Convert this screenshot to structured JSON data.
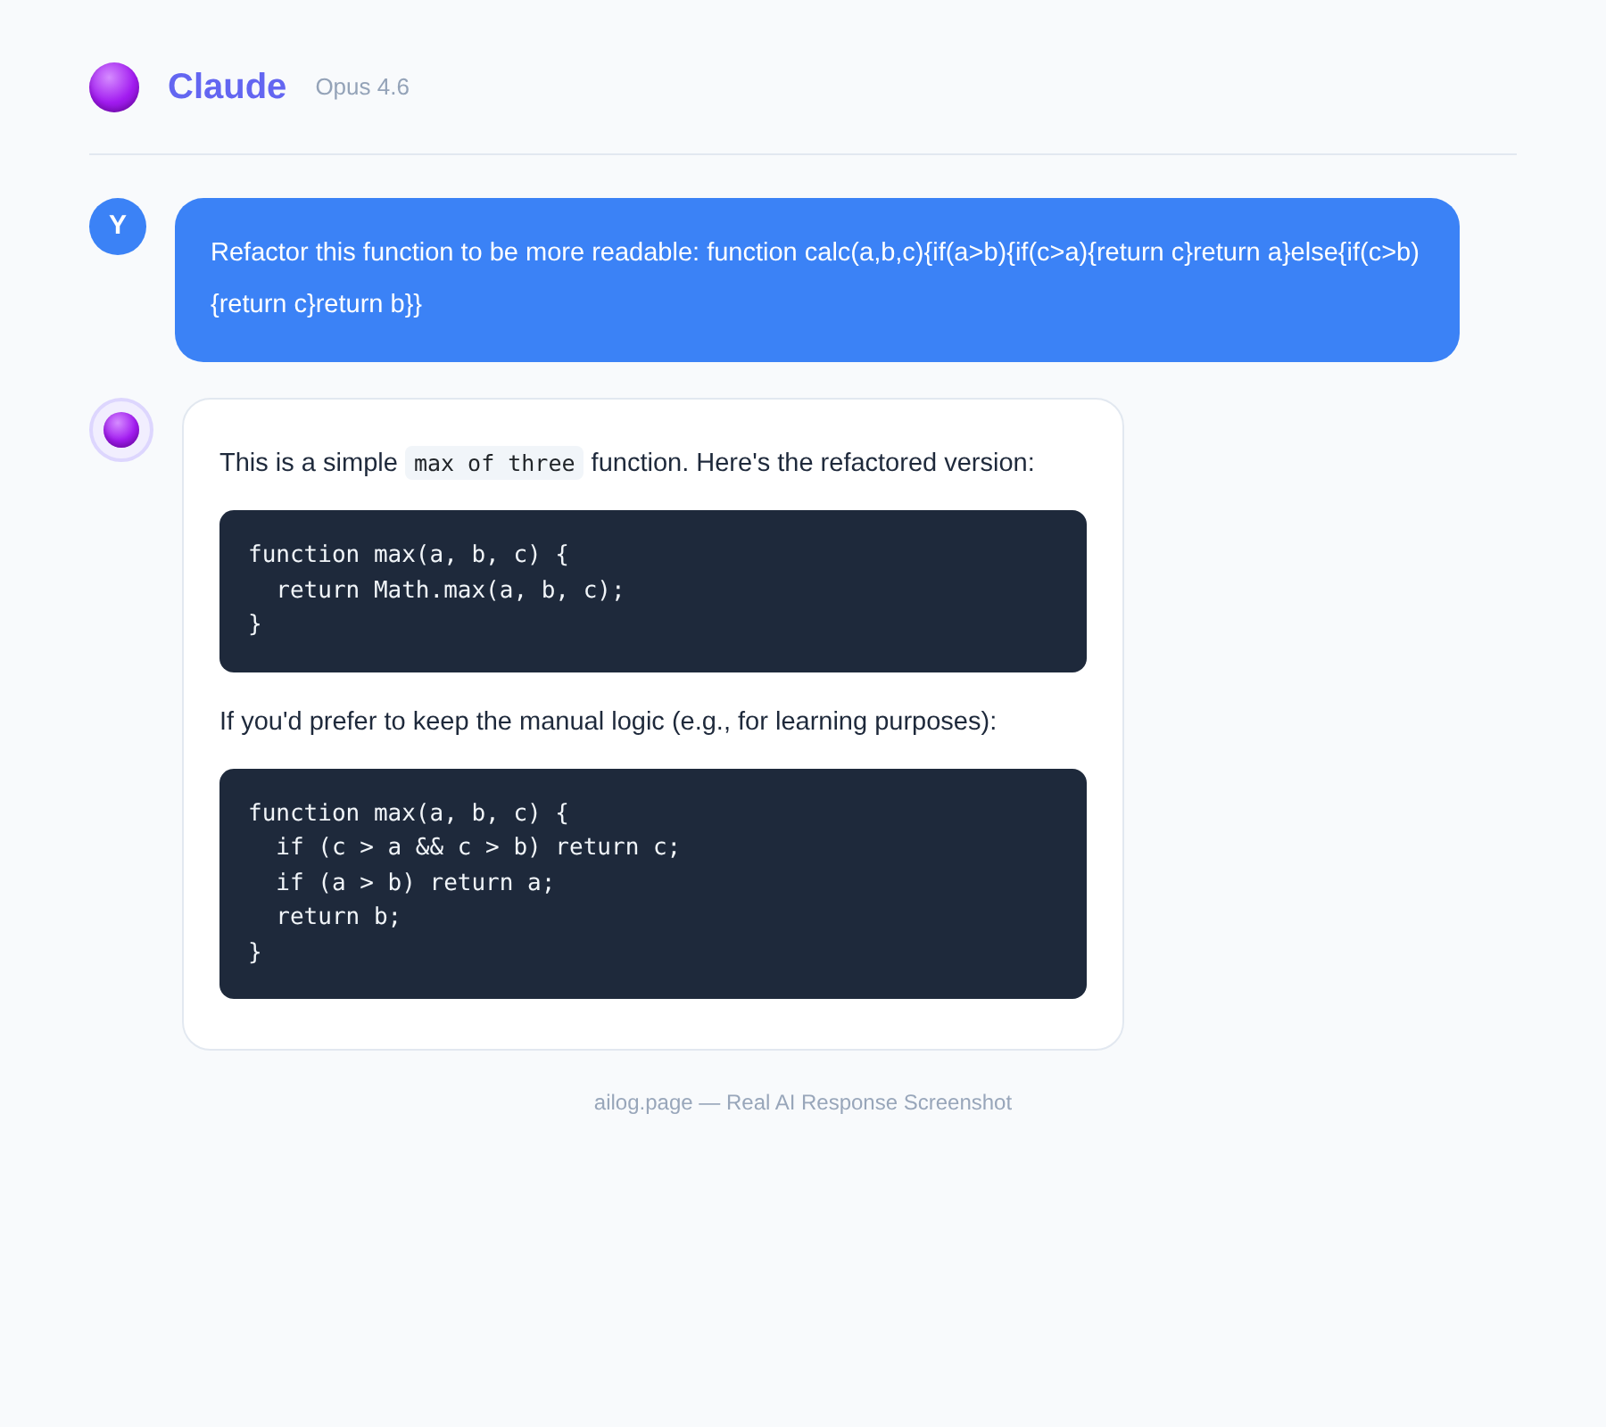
{
  "header": {
    "title": "Claude",
    "model": "Opus 4.6"
  },
  "messages": [
    {
      "kind": "user",
      "avatar": "Y",
      "text": "Refactor this function to be more readable: function calc(a,b,c){if(a>b){if(c>a){return c}return a}else{if(c>b){return c}return b}}"
    },
    {
      "kind": "assistant",
      "blocks": [
        {
          "kind": "paragraph",
          "parts": [
            {
              "kind": "text",
              "text": "This is a simple "
            },
            {
              "kind": "code",
              "text": "max of three"
            },
            {
              "kind": "text",
              "text": " function. Here's the refactored version:"
            }
          ]
        },
        {
          "kind": "code",
          "lines": [
            "function max(a, b, c) {",
            "  return Math.max(a, b, c);",
            "}"
          ]
        },
        {
          "kind": "paragraph",
          "parts": [
            {
              "kind": "text",
              "text": "If you'd prefer to keep the manual logic (e.g., for learning purposes):"
            }
          ]
        },
        {
          "kind": "code",
          "lines": [
            "function max(a, b, c) {",
            "  if (c > a && c > b) return c;",
            "  if (a > b) return a;",
            "  return b;",
            "}"
          ]
        }
      ]
    }
  ],
  "footer": "ailog.page — Real AI Response Screenshot"
}
